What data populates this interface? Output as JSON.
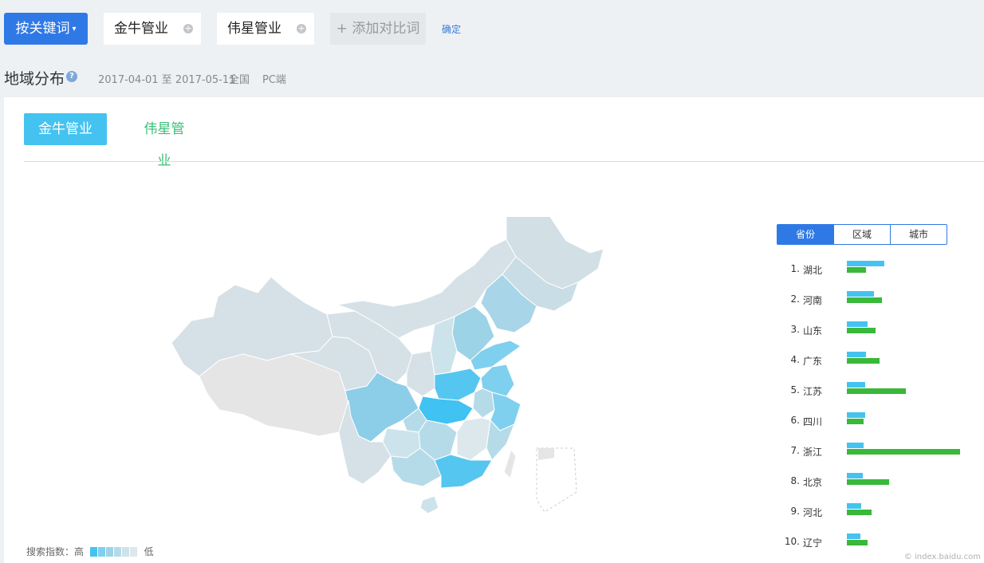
{
  "toolbar": {
    "keyword_button": "按关键词",
    "caret": "▾",
    "keywords": [
      "金牛管业",
      "伟星管业"
    ],
    "add_keyword": "+ 添加对比词",
    "confirm": "确定"
  },
  "header": {
    "title": "地域分布",
    "help": "?",
    "date_range": "2017-04-01 至 2017-05-11",
    "region": "全国",
    "device": "PC端"
  },
  "tabs": [
    "金牛管业",
    "伟星管业"
  ],
  "legend": {
    "label": "搜索指数：高",
    "low": "低",
    "colors": [
      "#45c3f0",
      "#7fd0ee",
      "#9dd3e7",
      "#b6dbe8",
      "#cde3ec",
      "#dde8ed"
    ]
  },
  "scope_tabs": [
    "省份",
    "区域",
    "城市"
  ],
  "ranking": [
    {
      "num": "1.",
      "name": "湖北",
      "a": 0.33,
      "b": 0.17
    },
    {
      "num": "2.",
      "name": "河南",
      "a": 0.24,
      "b": 0.31
    },
    {
      "num": "3.",
      "name": "山东",
      "a": 0.18,
      "b": 0.25
    },
    {
      "num": "4.",
      "name": "广东",
      "a": 0.17,
      "b": 0.29
    },
    {
      "num": "5.",
      "name": "江苏",
      "a": 0.16,
      "b": 0.52
    },
    {
      "num": "6.",
      "name": "四川",
      "a": 0.16,
      "b": 0.15
    },
    {
      "num": "7.",
      "name": "浙江",
      "a": 0.15,
      "b": 1.0
    },
    {
      "num": "8.",
      "name": "北京",
      "a": 0.14,
      "b": 0.37
    },
    {
      "num": "9.",
      "name": "河北",
      "a": 0.13,
      "b": 0.22
    },
    {
      "num": "10.",
      "name": "辽宁",
      "a": 0.12,
      "b": 0.18
    }
  ],
  "colors": {
    "primary": "#2f79e6",
    "tab_active": "#45c3f0",
    "series_a": "#45c3f0",
    "series_b": "#39b839"
  },
  "watermark": "© index.baidu.com"
}
